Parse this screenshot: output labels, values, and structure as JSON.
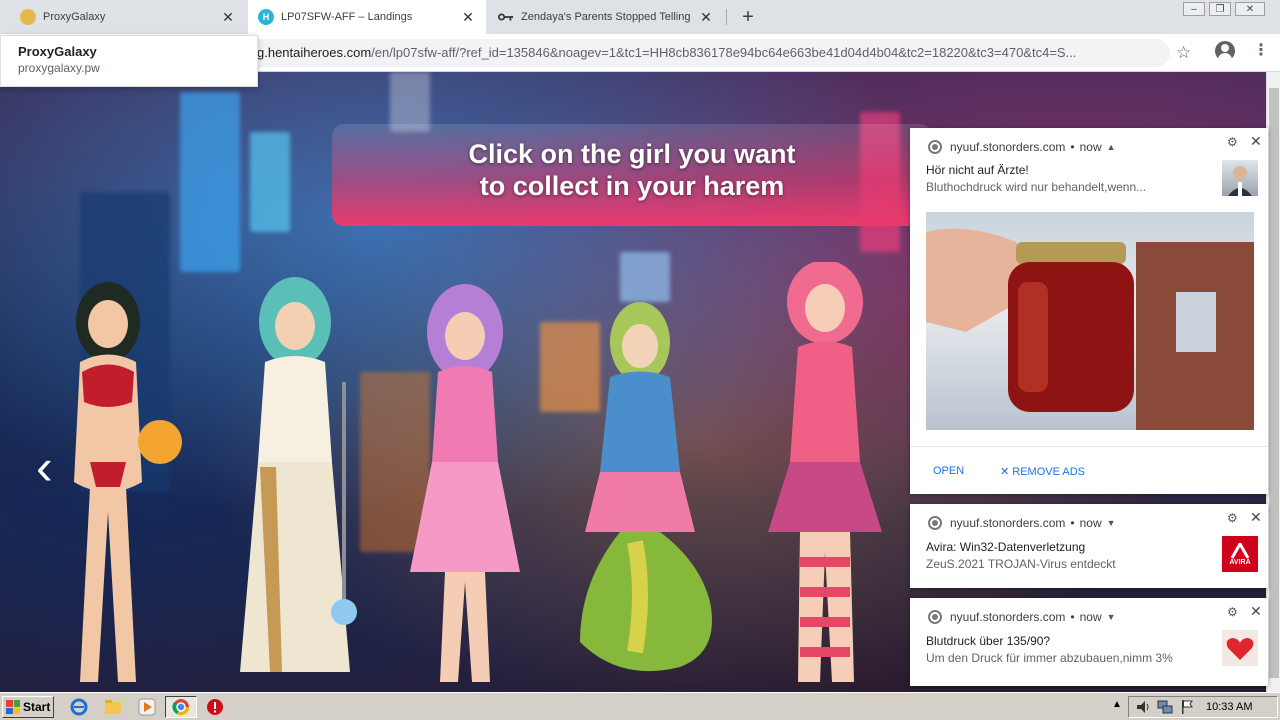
{
  "tabs": [
    {
      "title": "ProxyGalaxy",
      "favicon": "proxygalaxy-icon"
    },
    {
      "title": "LP07SFW-AFF – Landings",
      "favicon": "hentaiheroes-icon",
      "active": true
    },
    {
      "title": "Zendaya's Parents Stopped Telling H",
      "favicon": "key-icon"
    }
  ],
  "hovercard": {
    "title": "ProxyGalaxy",
    "url": "proxygalaxy.pw"
  },
  "omnibox": {
    "host": "g.hentaiheroes.com",
    "path": "/en/lp07sfw-aff/?ref_id=135846&noagev=1&tc1=HH8cb836178e94bc64e663be41d04d4b04&tc2=18220&tc3=470&tc4=S..."
  },
  "page": {
    "banner_line1": "Click on the girl you want",
    "banner_line2": "to collect in your harem",
    "arrow": "‹"
  },
  "notifications": [
    {
      "source": "nyuuf.stonorders.com",
      "time": "now",
      "title": "Hör nicht auf Ärzte!",
      "body": "Bluthochdruck wird nur behandelt,wenn...",
      "open_label": "OPEN",
      "remove_label": "REMOVE ADS"
    },
    {
      "source": "nyuuf.stonorders.com",
      "time": "now",
      "title": "Avira: Win32-Datenverletzung",
      "body": "ZeuS.2021 TROJAN-Virus entdeckt",
      "thumb_text": "AVIRA"
    },
    {
      "source": "nyuuf.stonorders.com",
      "time": "now",
      "title": "Blutdruck über 135/90?",
      "body": "Um den Druck für immer abzubauen,nimm 3%"
    }
  ],
  "taskbar": {
    "start_label": "Start",
    "clock": "10:33 AM"
  },
  "colors": {
    "banner": "#e93a6d",
    "accent": "#1a73e8",
    "avira": "#d0021b"
  }
}
